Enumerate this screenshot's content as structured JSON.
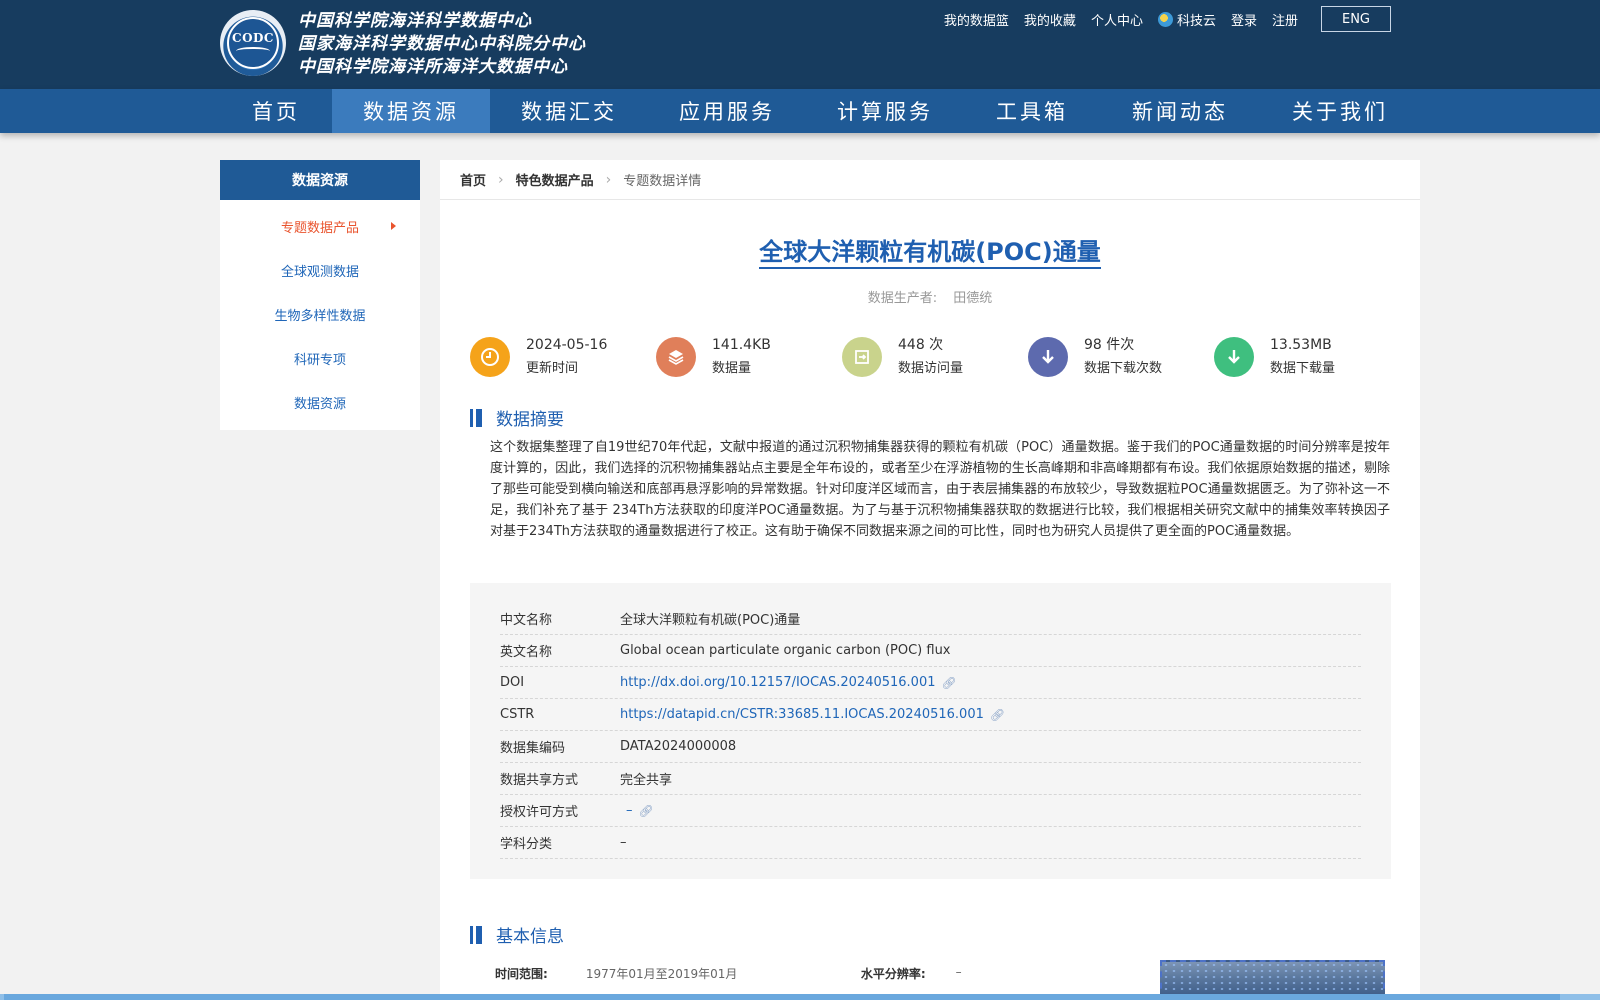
{
  "header": {
    "logo_text": "CODC",
    "org_lines": [
      "中国科学院海洋科学数据中心",
      "国家海洋科学数据中心中科院分中心",
      "中国科学院海洋所海洋大数据中心"
    ],
    "links": [
      "我的数据篮",
      "我的收藏",
      "个人中心",
      "科技云",
      "登录",
      "注册"
    ],
    "lang_button": "ENG"
  },
  "nav": {
    "items": [
      "首页",
      "数据资源",
      "数据汇交",
      "应用服务",
      "计算服务",
      "工具箱",
      "新闻动态",
      "关于我们"
    ],
    "active_index": 1
  },
  "sidebar": {
    "title": "数据资源",
    "items": [
      "专题数据产品",
      "全球观测数据",
      "生物多样性数据",
      "科研专项",
      "数据资源"
    ],
    "active_index": 0
  },
  "breadcrumb": [
    "首页",
    "特色数据产品",
    "专题数据详情"
  ],
  "dataset": {
    "title": "全球大洋颗粒有机碳(POC)通量",
    "producer_label": "数据生产者:",
    "producer": "田德统",
    "stats": [
      {
        "value": "2024-05-16",
        "label": "更新时间",
        "icon": "clock-icon",
        "color": "#f5a31a"
      },
      {
        "value": "141.4KB",
        "label": "数据量",
        "icon": "layers-icon",
        "color": "#e07f5a"
      },
      {
        "value": "448 次",
        "label": "数据访问量",
        "icon": "enter-icon",
        "color": "#c9d38c"
      },
      {
        "value": "98 件次",
        "label": "数据下载次数",
        "icon": "download-icon",
        "color": "#5d6aae"
      },
      {
        "value": "13.53MB",
        "label": "数据下载量",
        "icon": "download-icon",
        "color": "#3fbf7f"
      }
    ],
    "abstract_title": "数据摘要",
    "abstract": "这个数据集整理了自19世纪70年代起，文献中报道的通过沉积物捕集器获得的颗粒有机碳（POC）通量数据。鉴于我们的POC通量数据的时间分辨率是按年度计算的，因此，我们选择的沉积物捕集器站点主要是全年布设的，或者至少在浮游植物的生长高峰期和非高峰期都有布设。我们依据原始数据的描述，剔除了那些可能受到横向输送和底部再悬浮影响的异常数据。针对印度洋区域而言，由于表层捕集器的布放较少，导致数据粒POC通量数据匮乏。为了弥补这一不足，我们补充了基于 234Th方法获取的印度洋POC通量数据。为了与基于沉积物捕集器获取的数据进行比较，我们根据相关研究文献中的捕集效率转换因子对基于234Th方法获取的通量数据进行了校正。这有助于确保不同数据来源之间的可比性，同时也为研究人员提供了更全面的POC通量数据。",
    "meta": [
      {
        "key": "中文名称",
        "value": "全球大洋颗粒有机碳(POC)通量",
        "link": false
      },
      {
        "key": "英文名称",
        "value": "Global ocean particulate organic carbon (POC) flux",
        "link": false
      },
      {
        "key": "DOI",
        "value": "http://dx.doi.org/10.12157/IOCAS.20240516.001",
        "link": true
      },
      {
        "key": "CSTR",
        "value": "https://datapid.cn/CSTR:33685.11.IOCAS.20240516.001",
        "link": true
      },
      {
        "key": "数据集编码",
        "value": "DATA2024000008",
        "link": false
      },
      {
        "key": "数据共享方式",
        "value": "完全共享",
        "link": false
      },
      {
        "key": "授权许可方式",
        "value": "–",
        "link": true
      },
      {
        "key": "学科分类",
        "value": "–",
        "link": false
      }
    ],
    "basic_title": "基本信息",
    "basic": {
      "time_label": "时间范围:",
      "time_value": "1977年01月至2019年01月",
      "res_label": "水平分辨率:",
      "res_value": "–"
    }
  }
}
